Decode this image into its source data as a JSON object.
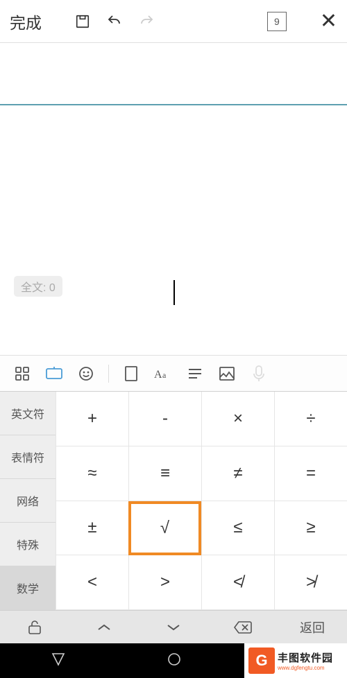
{
  "toolbar": {
    "done": "完成",
    "page": "9"
  },
  "wordcount": {
    "label": "全文: 0"
  },
  "categories": {
    "items": [
      {
        "label": "英文符"
      },
      {
        "label": "表情符"
      },
      {
        "label": "网络"
      },
      {
        "label": "特殊"
      },
      {
        "label": "数学"
      }
    ]
  },
  "symbols": {
    "r0": {
      "c0": "+",
      "c1": "-",
      "c2": "×",
      "c3": "÷"
    },
    "r1": {
      "c0": "≈",
      "c1": "≡",
      "c2": "≠",
      "c3": "="
    },
    "r2": {
      "c0": "±",
      "c1": "√",
      "c2": "≤",
      "c3": "≥"
    },
    "r3": {
      "c0": "<",
      "c1": ">",
      "c2": "≮",
      "c3": "≯"
    }
  },
  "bottom": {
    "return": "返回"
  },
  "watermark": {
    "logo": "G",
    "main": "丰图软件园",
    "sub": "www.dgfengtu.com"
  }
}
